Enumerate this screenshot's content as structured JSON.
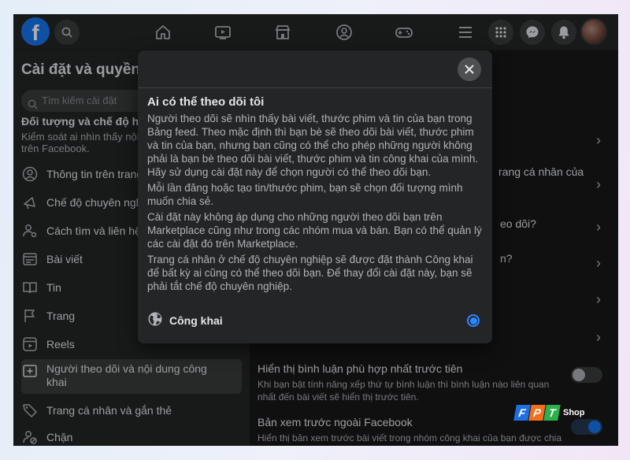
{
  "colors": {
    "accent": "#1877f2",
    "background": "#18191a",
    "surface": "#242526"
  },
  "topbar": {
    "logo": "f",
    "icons": [
      "search-icon",
      "home-icon",
      "video-icon",
      "marketplace-icon",
      "groups-icon",
      "gaming-icon",
      "menu-icon",
      "apps-grid-icon",
      "messenger-icon",
      "notifications-icon",
      "profile-avatar"
    ]
  },
  "sidebar": {
    "title": "Cài đặt và quyền",
    "search_placeholder": "Tìm kiếm cài đặt",
    "section_title": "Đối tượng và chế độ hiển thị",
    "section_desc": "Kiểm soát ai nhìn thấy nội dung bạn chia sẻ trên Facebook.",
    "items": [
      {
        "label": "Thông tin trên trang cá nhân",
        "icon": "user-icon"
      },
      {
        "label": "Chế độ chuyên nghiệp",
        "icon": "megaphone-icon"
      },
      {
        "label": "Cách tìm và liên hệ với bạn",
        "icon": "user-search-icon"
      },
      {
        "label": "Bài viết",
        "icon": "post-icon"
      },
      {
        "label": "Tin",
        "icon": "story-book-icon"
      },
      {
        "label": "Trang",
        "icon": "flag-icon"
      },
      {
        "label": "Reels",
        "icon": "reels-icon"
      },
      {
        "label": "Người theo dõi và nội dung công khai",
        "icon": "followers-icon"
      },
      {
        "label": "Trang cá nhân và gắn thẻ",
        "icon": "tag-icon"
      },
      {
        "label": "Chặn",
        "icon": "block-user-icon"
      }
    ]
  },
  "main": {
    "row1_fragment": "rang cá nhân của",
    "row2_fragment": "eo dõi?",
    "row3_fragment": "n?",
    "comment_title": "Hiển thị bình luận phù hợp nhất trước tiên",
    "comment_desc": "Khi bạn bật tính năng xếp thứ tự bình luận thì bình luận nào liên quan nhất đến bài viết sẽ hiển thị trước tiên.",
    "comment_toggle": "off",
    "preview_title": "Bản xem trước ngoài Facebook",
    "preview_desc": "Hiển thị bản xem trước bài viết trong nhóm công khai của bạn được chia sẻ ra bên ngoài Facebook. Bản xem trước có thể bao gồm",
    "preview_toggle": "on"
  },
  "modal": {
    "title": "Ai có thể theo dõi tôi",
    "paragraphs": [
      "Người theo dõi sẽ nhìn thấy bài viết, thước phim và tin của bạn trong Bảng feed. Theo mặc định thì bạn bè sẽ theo dõi bài viết, thước phim và tin của bạn, nhưng bạn cũng có thể cho phép những người không phải là bạn bè theo dõi bài viết, thước phim và tin công khai của mình. Hãy sử dụng cài đặt này để chọn người có thể theo dõi bạn.",
      "Mỗi lần đăng hoặc tạo tin/thước phim, bạn sẽ chọn đối tượng mình muốn chia sẻ.",
      "Cài đặt này không áp dụng cho những người theo dõi bạn trên Marketplace cũng như trong các nhóm mua và bán. Bạn có thể quản lý các cài đặt đó trên Marketplace.",
      "Trang cá nhân ở chế độ chuyên nghiệp sẽ được đặt thành Công khai để bất kỳ ai cũng có thể theo dõi bạn. Để thay đổi cài đặt này, bạn sẽ phải tắt chế độ chuyên nghiệp."
    ],
    "option_label": "Công khai",
    "option_selected": true
  },
  "watermark": {
    "letters": [
      "F",
      "P",
      "T"
    ],
    "shop": "Shop",
    "colors": [
      "#1e6fe0",
      "#f26f21",
      "#2db04b"
    ]
  }
}
